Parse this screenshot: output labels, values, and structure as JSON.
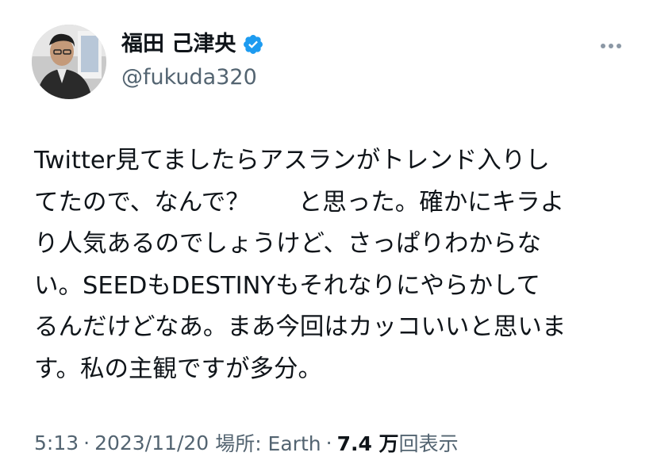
{
  "author": {
    "display_name": "福田 己津央",
    "handle": "@fukuda320",
    "verified_icon": "verified-badge-icon",
    "verified_color": "#1d9bf0"
  },
  "tweet": {
    "lines": [
      "Twitter見てましたらアスランがトレンド入りし",
      "てたので、なんで？　　と思った。確かにキラよ",
      "り人気あるのでしょうけど、さっぱりわからな",
      "い。SEEDもDESTINYもそれなりにやらかして",
      "るんだけどなあ。まあ今回はカッコいいと思いま",
      "す。私の主観ですが多分。"
    ]
  },
  "meta": {
    "time": "5:13",
    "separator": "·",
    "date": "2023/11/20",
    "location_label": "場所: Earth",
    "views_count": "7.4 万",
    "views_label": "回表示"
  },
  "colors": {
    "text_primary": "#0f1419",
    "text_secondary": "#536471",
    "background": "#ffffff"
  }
}
